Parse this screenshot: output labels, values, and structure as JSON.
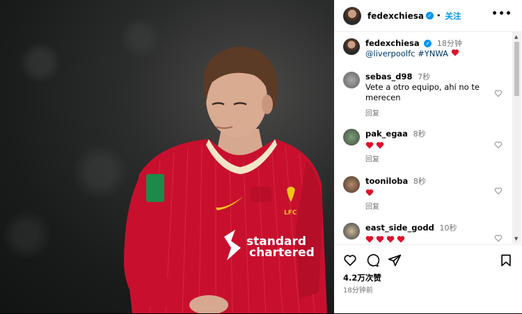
{
  "post": {
    "username": "fedexchiesa",
    "follow_label": "关注",
    "more_label": "•••",
    "caption_username": "fedexchiesa",
    "caption_time": "18分钟",
    "caption_mention": "@liverpoolfc",
    "caption_hashtag": "#YNWA",
    "likes": "4.2万次赞",
    "posted_time": "18分钟前"
  },
  "comments": [
    {
      "username": "sebas_d98",
      "time": "7秒",
      "text": "Vete a otro equipo, ahí no te merecen",
      "hearts": 0,
      "reply_label": "回复"
    },
    {
      "username": "pak_egaa",
      "time": "8秒",
      "text": "",
      "hearts": 2,
      "reply_label": "回复"
    },
    {
      "username": "tooniloba",
      "time": "8秒",
      "text": "",
      "hearts": 1,
      "reply_label": "回复"
    },
    {
      "username": "east_side_godd",
      "time": "10秒",
      "text": "",
      "hearts": 4,
      "reply_label": ""
    }
  ],
  "photo": {
    "sponsor_line1": "standard",
    "sponsor_line2": "chartered",
    "club_badge": "LFC"
  },
  "colors": {
    "jersey": "#c8102e",
    "link": "#0095f6",
    "heart": "#e0112b"
  }
}
